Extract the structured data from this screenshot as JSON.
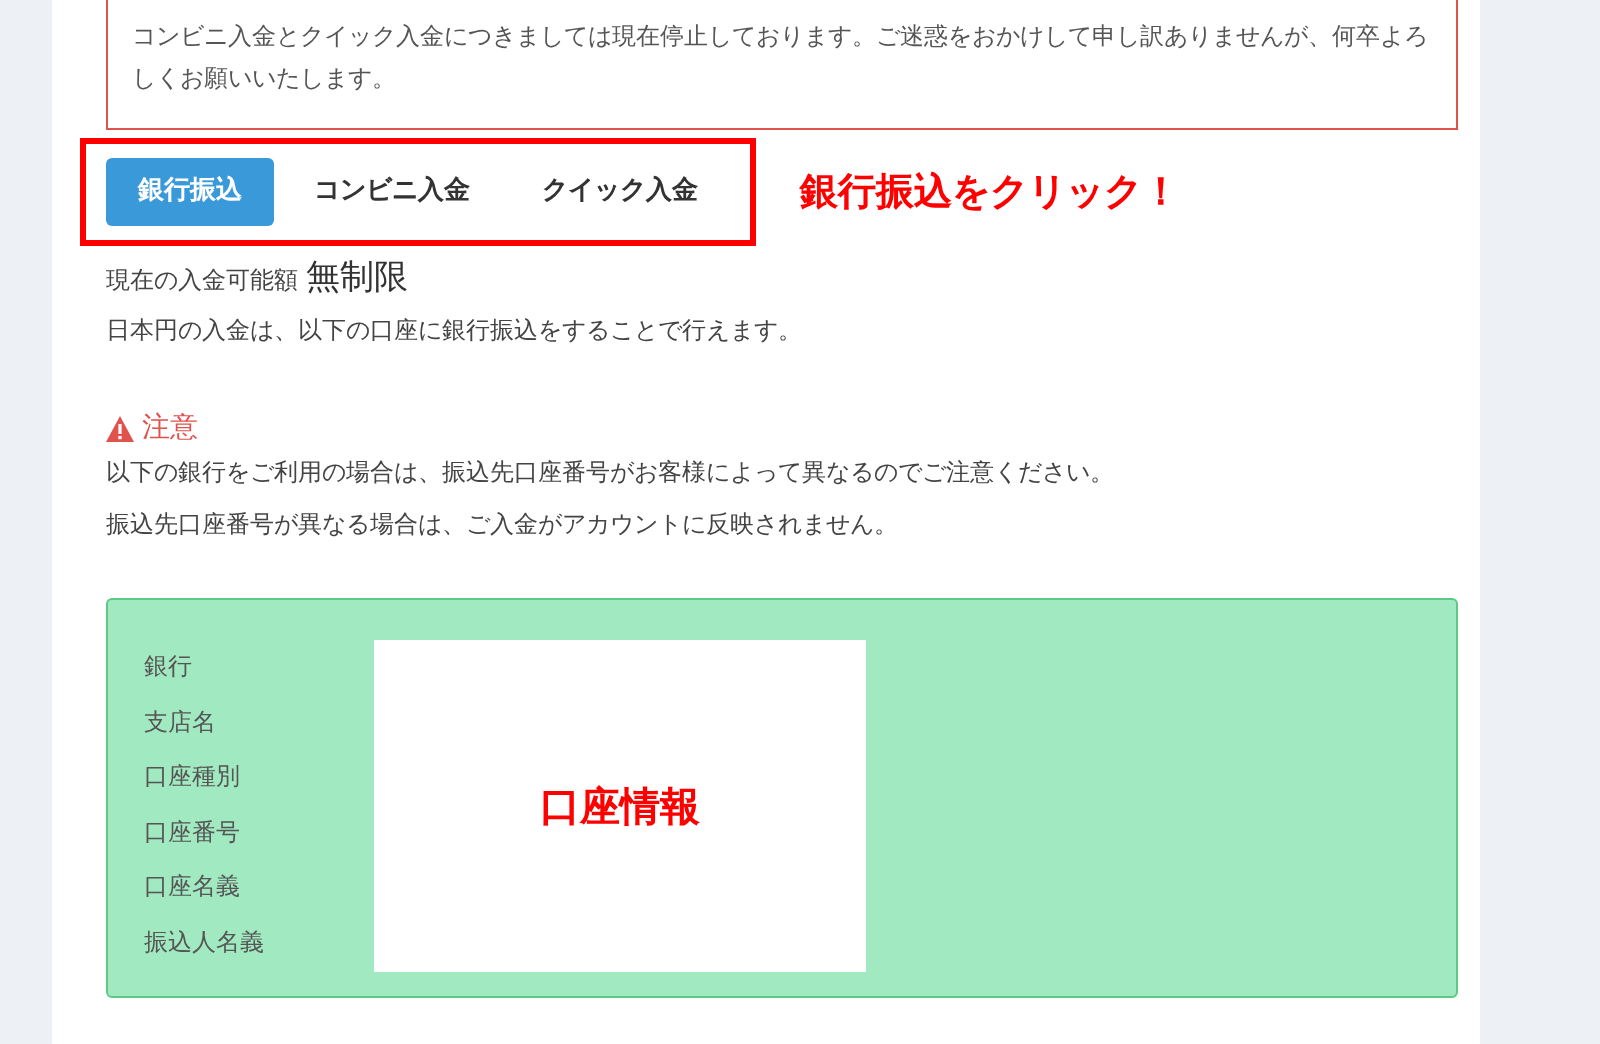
{
  "notice": {
    "text": "コンビニ入金とクイック入金につきましては現在停止しております。ご迷惑をおかけして申し訳ありませんが、何卒よろしくお願いいたします。"
  },
  "tabs": [
    {
      "label": "銀行振込",
      "selected": true
    },
    {
      "label": "コンビニ入金",
      "selected": false
    },
    {
      "label": "クイック入金",
      "selected": false
    }
  ],
  "annotation": "銀行振込をクリック！",
  "available": {
    "label": "現在の入金可能額",
    "value": "無制限"
  },
  "description": "日本円の入金は、以下の口座に銀行振込をすることで行えます。",
  "caution": {
    "title": "注意",
    "lines": [
      "以下の銀行をご利用の場合は、振込先口座番号がお客様によって異なるのでご注意ください。",
      "振込先口座番号が異なる場合は、ご入金がアカウントに反映されません。"
    ]
  },
  "account": {
    "fields": [
      "銀行",
      "支店名",
      "口座種別",
      "口座番号",
      "口座名義",
      "振込人名義"
    ],
    "cover_label": "口座情報"
  }
}
